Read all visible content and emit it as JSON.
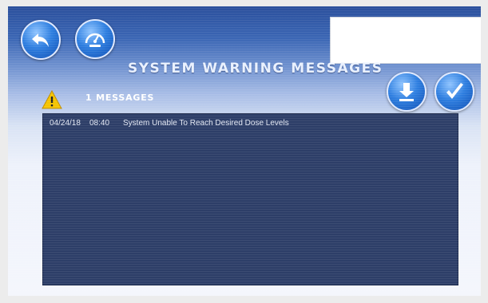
{
  "header": {
    "title": "SYSTEM WARNING MESSAGES",
    "message_count": "1 MESSAGES"
  },
  "buttons": {
    "back": {
      "icon": "back-arrow-icon"
    },
    "gauge": {
      "icon": "speedometer-icon"
    },
    "download": {
      "icon": "download-icon"
    },
    "confirm": {
      "icon": "checkmark-icon"
    }
  },
  "messages": [
    {
      "date": "04/24/18",
      "time": "08:40",
      "text": "System Unable To Reach Desired Dose Levels"
    }
  ],
  "colors": {
    "header_blue": "#2a4f9c",
    "button_blue": "#2f7fe0",
    "panel_navy": "#2d3e68",
    "warning_yellow": "#f5c400"
  }
}
